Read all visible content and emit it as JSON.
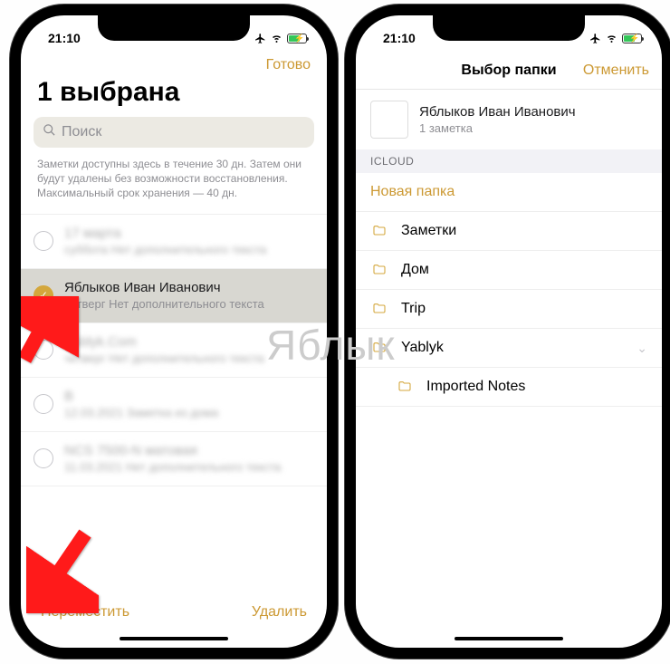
{
  "status": {
    "time": "21:10"
  },
  "left": {
    "done": "Готово",
    "title": "1 выбрана",
    "search_placeholder": "Поиск",
    "info": "Заметки доступны здесь в течение 30 дн. Затем они будут удалены без возможности восстановления. Максимальный срок хранения — 40 дн.",
    "notes": [
      {
        "title": "17 марта",
        "sub": "суббота Нет дополнительного текста"
      },
      {
        "title": "Яблыков Иван Иванович",
        "sub": "четверг  Нет дополнительного текста"
      },
      {
        "title": "Yablyk.Com",
        "sub": "четверг Нет дополнительного текста"
      },
      {
        "title": "В",
        "sub": "12.03.2021 Заметка из дома"
      },
      {
        "title": "NCS 7500-N матовая",
        "sub": "11.03.2021 Нет дополнительного текста"
      }
    ],
    "move": "Переместить",
    "delete": "Удалить"
  },
  "right": {
    "nav_title": "Выбор папки",
    "cancel": "Отменить",
    "selected_title": "Яблыков Иван Иванович",
    "selected_sub": "1 заметка",
    "section": "ICLOUD",
    "new_folder": "Новая папка",
    "folders": [
      {
        "name": "Заметки",
        "indent": false,
        "chevron": false
      },
      {
        "name": "Дом",
        "indent": false,
        "chevron": false
      },
      {
        "name": "Trip",
        "indent": false,
        "chevron": false
      },
      {
        "name": "Yablyk",
        "indent": false,
        "chevron": true
      },
      {
        "name": "Imported Notes",
        "indent": true,
        "chevron": false
      }
    ]
  },
  "watermark": "Яблык"
}
